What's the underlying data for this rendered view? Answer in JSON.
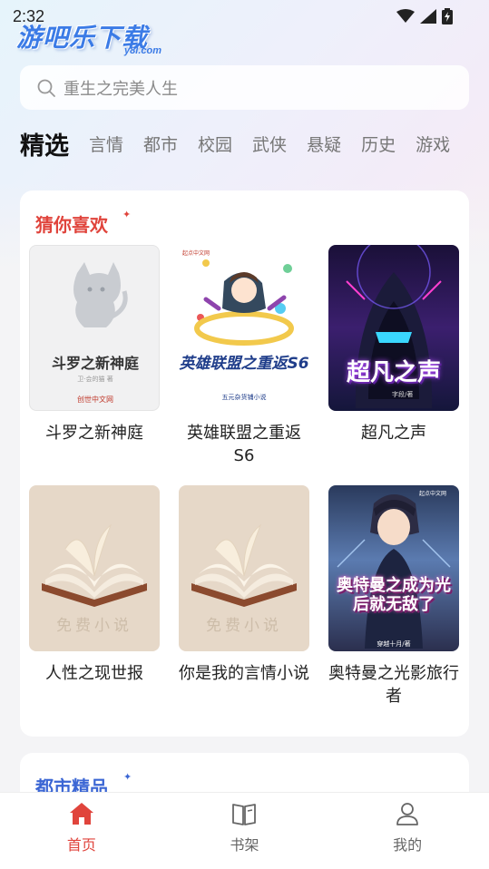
{
  "status": {
    "time": "2:32"
  },
  "logo": {
    "main": "游吧乐下载",
    "sub": "y8l.com"
  },
  "search": {
    "placeholder": "重生之完美人生"
  },
  "categories": {
    "active": "精选",
    "items": [
      "言情",
      "都市",
      "校园",
      "武侠",
      "悬疑",
      "历史",
      "游戏"
    ]
  },
  "section1": {
    "title": "猜你喜欢",
    "books": [
      {
        "title": "斗罗之新神庭",
        "cover_text": "斗罗之新神庭",
        "cover_author": "卫·会的猫 著",
        "cover_brand": "创世中文网"
      },
      {
        "title": "英雄联盟之重返S6",
        "cover_text": "英雄联盟之重返S6",
        "cover_sub": "五元杂货铺小说",
        "cover_brand": "起点中文网"
      },
      {
        "title": "超凡之声",
        "cover_text": "超凡之声",
        "cover_author": "字段/著"
      },
      {
        "title": "人性之现世报",
        "cover_text": "免费小说"
      },
      {
        "title": "你是我的言情小说",
        "cover_text": "免费小说"
      },
      {
        "title": "奥特曼之光影旅行者",
        "cover_text": "奥特曼之成为光后就无敌了",
        "cover_author": "穿越十月/著",
        "cover_brand": "起点中文网"
      }
    ]
  },
  "section2": {
    "title": "都市精品"
  },
  "tabbar": {
    "items": [
      {
        "label": "首页",
        "icon": "home-icon",
        "active": true
      },
      {
        "label": "书架",
        "icon": "bookshelf-icon",
        "active": false
      },
      {
        "label": "我的",
        "icon": "profile-icon",
        "active": false
      }
    ]
  },
  "colors": {
    "accent": "#e0443c",
    "logo_blue": "#3b7be6",
    "section2_blue": "#3b66d4"
  }
}
